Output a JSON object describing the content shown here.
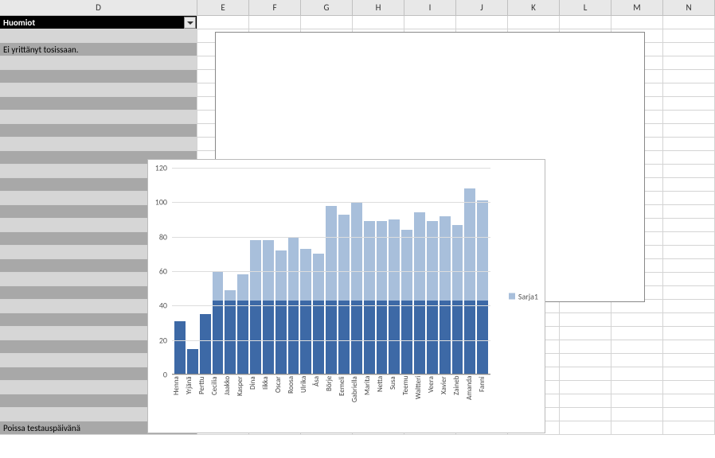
{
  "columns": [
    "D",
    "E",
    "F",
    "G",
    "H",
    "I",
    "J",
    "K",
    "L",
    "M",
    "N"
  ],
  "header_row": {
    "d_label": "Huomiot"
  },
  "rows": [
    {
      "shade": "light",
      "text": ""
    },
    {
      "shade": "dark",
      "text": "Ei yrittänyt tosissaan."
    },
    {
      "shade": "light",
      "text": ""
    },
    {
      "shade": "dark",
      "text": ""
    },
    {
      "shade": "light",
      "text": ""
    },
    {
      "shade": "dark",
      "text": ""
    },
    {
      "shade": "light",
      "text": ""
    },
    {
      "shade": "dark",
      "text": ""
    },
    {
      "shade": "light",
      "text": ""
    },
    {
      "shade": "dark",
      "text": ""
    },
    {
      "shade": "light",
      "text": ""
    },
    {
      "shade": "dark",
      "text": ""
    },
    {
      "shade": "light",
      "text": ""
    },
    {
      "shade": "dark",
      "text": ""
    },
    {
      "shade": "light",
      "text": ""
    },
    {
      "shade": "dark",
      "text": ""
    },
    {
      "shade": "light",
      "text": ""
    },
    {
      "shade": "dark",
      "text": ""
    },
    {
      "shade": "light",
      "text": ""
    },
    {
      "shade": "dark",
      "text": ""
    },
    {
      "shade": "light",
      "text": ""
    },
    {
      "shade": "dark",
      "text": ""
    },
    {
      "shade": "light",
      "text": ""
    },
    {
      "shade": "dark",
      "text": ""
    },
    {
      "shade": "light",
      "text": ""
    },
    {
      "shade": "dark",
      "text": ""
    },
    {
      "shade": "light",
      "text": ""
    },
    {
      "shade": "dark",
      "text": ""
    },
    {
      "shade": "light",
      "text": ""
    },
    {
      "shade": "dark",
      "text": "Poissa testauspäivänä"
    }
  ],
  "chart_data": {
    "type": "bar",
    "title": "",
    "xlabel": "",
    "ylabel": "",
    "ylim": [
      0,
      120
    ],
    "y_ticks": [
      0,
      20,
      40,
      60,
      80,
      100,
      120
    ],
    "legend": "Sarja1",
    "overlay_threshold": 43,
    "categories": [
      "Henna",
      "Yrjänä",
      "Perttu",
      "Cecilia",
      "Jaakko",
      "Kasper",
      "Dina",
      "Iikka",
      "Oscar",
      "Roosa",
      "Ulrika",
      "Åsa",
      "Börje",
      "Eemeli",
      "Gabriella",
      "Marita",
      "Netta",
      "Susa",
      "Teemu",
      "Waltteri",
      "Veera",
      "Xavier",
      "Zaineb",
      "Amanda",
      "Fanni"
    ],
    "values": [
      31,
      15,
      35,
      60,
      49,
      58,
      78,
      78,
      72,
      80,
      73,
      70,
      98,
      93,
      100,
      89,
      89,
      90,
      84,
      94,
      89,
      92,
      87,
      108,
      101
    ]
  }
}
